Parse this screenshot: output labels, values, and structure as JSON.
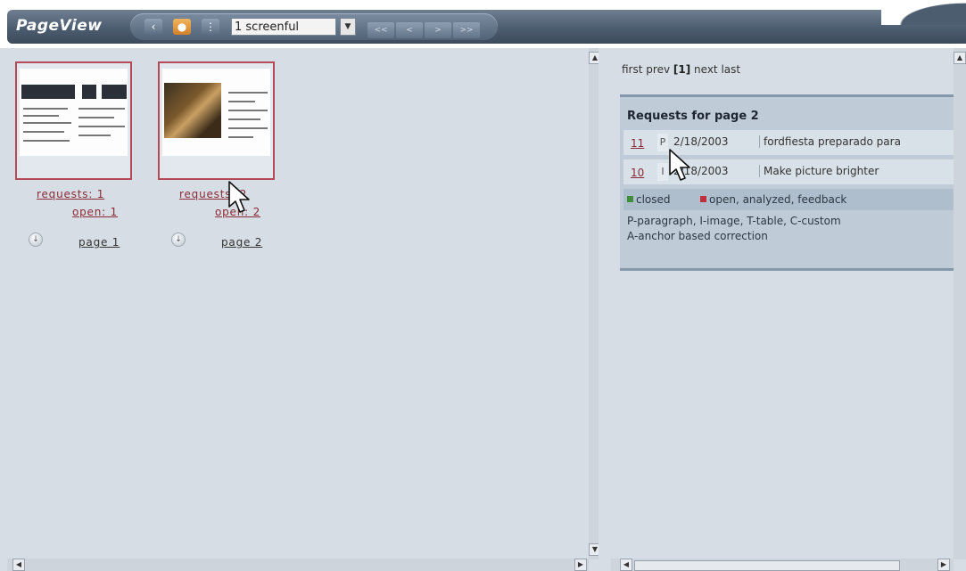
{
  "app": {
    "title": "PageView"
  },
  "toolbar": {
    "prev_icon": "chevron-left-icon",
    "view_icon": "orange-circle-icon",
    "grid_icon": "grid-icon",
    "view_select": "1 screenful",
    "nav_first": "<<",
    "nav_prev": "<",
    "nav_next": ">",
    "nav_last": ">>"
  },
  "pages": [
    {
      "requests": "requests: 1",
      "open": "open: 1",
      "label": "page 1"
    },
    {
      "requests": "requests: 2",
      "open": "open: 2",
      "label": "page 2"
    }
  ],
  "right": {
    "pager": {
      "first": "first",
      "prev": "prev",
      "current": "[1]",
      "next": "next",
      "last": "last"
    },
    "panel_title": "Requests for page 2",
    "requests": [
      {
        "id": "11",
        "type": "P",
        "date": "2/18/2003",
        "desc": "fordfiesta preparado para"
      },
      {
        "id": "10",
        "type": "I",
        "date": "2/18/2003",
        "desc": "Make picture brighter"
      }
    ],
    "legend": {
      "closed": "closed",
      "open": "open, analyzed, feedback",
      "closed_color": "#3f8f3a",
      "open_color": "#c0303a"
    },
    "key_line1": "P-paragraph, I-image, T-table, C-custom",
    "key_line2": "A-anchor based correction"
  }
}
